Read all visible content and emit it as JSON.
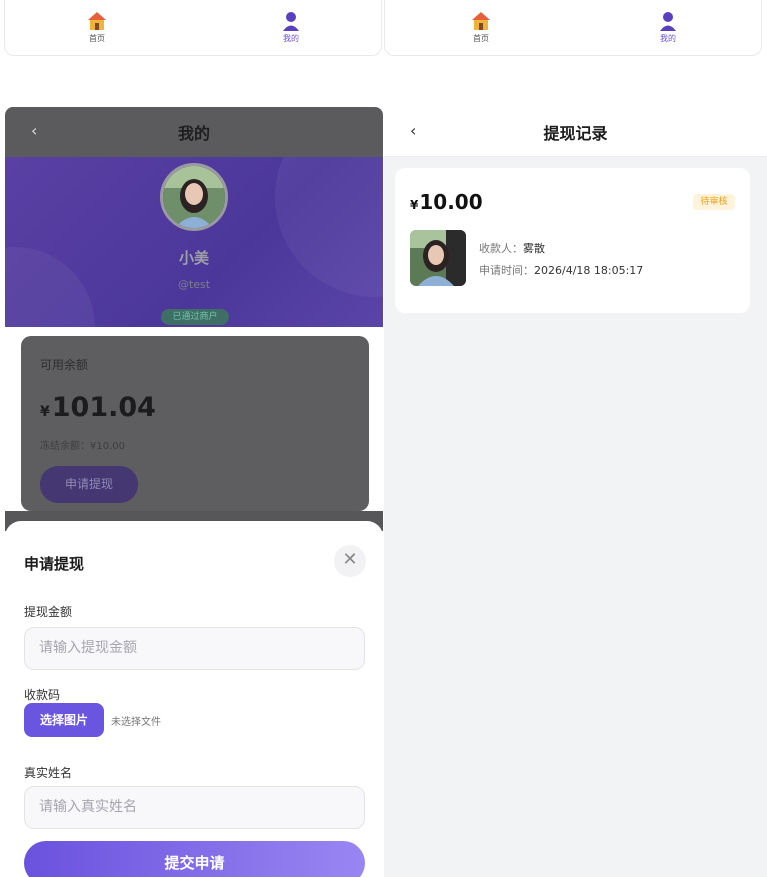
{
  "tabbars": [
    {
      "home_label": "首页",
      "me_label": "我的"
    },
    {
      "home_label": "首页",
      "me_label": "我的"
    }
  ],
  "profile_page": {
    "back_icon": "‹",
    "title": "我的",
    "username": "小美",
    "handle": "@test",
    "verified_badge": "已通过商户",
    "balance_card": {
      "label": "可用余额",
      "currency": "¥",
      "amount": "101.04",
      "frozen": "冻结余额：¥10.00",
      "withdraw_button": "申请提现"
    }
  },
  "withdraw_sheet": {
    "title": "申请提现",
    "close_icon": "✕",
    "amount_label": "提现金额",
    "amount_placeholder": "请输入提现金额",
    "qrcode_label": "收款码",
    "pick_image_button": "选择图片",
    "no_file_text": "未选择文件",
    "realname_label": "真实姓名",
    "realname_placeholder": "请输入真实姓名",
    "submit_button": "提交申请"
  },
  "records_page": {
    "back_icon": "‹",
    "title": "提现记录",
    "records": [
      {
        "currency": "¥",
        "amount": "10.00",
        "status": "待审核",
        "payee_label": "收款人：",
        "payee": "雾散",
        "time_label": "申请时间：",
        "time": "2026/4/18 18:05:17"
      }
    ]
  },
  "colors": {
    "accent": "#6a55e0",
    "status_pending": "#f29f1a"
  }
}
